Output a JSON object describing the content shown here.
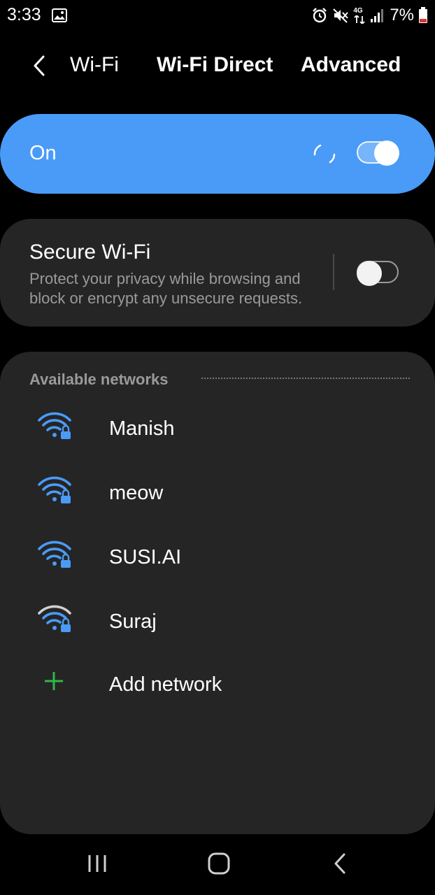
{
  "status_bar": {
    "time": "3:33",
    "network_type": "4G",
    "battery": "7%"
  },
  "tabs": {
    "wifi": "Wi-Fi",
    "wifi_direct": "Wi-Fi Direct",
    "advanced": "Advanced"
  },
  "wifi_master": {
    "label": "On",
    "enabled": true
  },
  "secure_wifi": {
    "title": "Secure Wi-Fi",
    "description": "Protect your privacy while browsing and block or encrypt any unsecure requests.",
    "enabled": false
  },
  "networks": {
    "header": "Available networks",
    "items": [
      {
        "name": "Manish",
        "secured": true
      },
      {
        "name": "meow",
        "secured": true
      },
      {
        "name": "SUSI.AI",
        "secured": true
      },
      {
        "name": "Suraj",
        "secured": true
      }
    ],
    "add_label": "Add network"
  },
  "colors": {
    "accent": "#4a9bf7",
    "add_green": "#2eb84a",
    "card_bg": "#252525",
    "secondary_text": "#9a9a9a"
  }
}
